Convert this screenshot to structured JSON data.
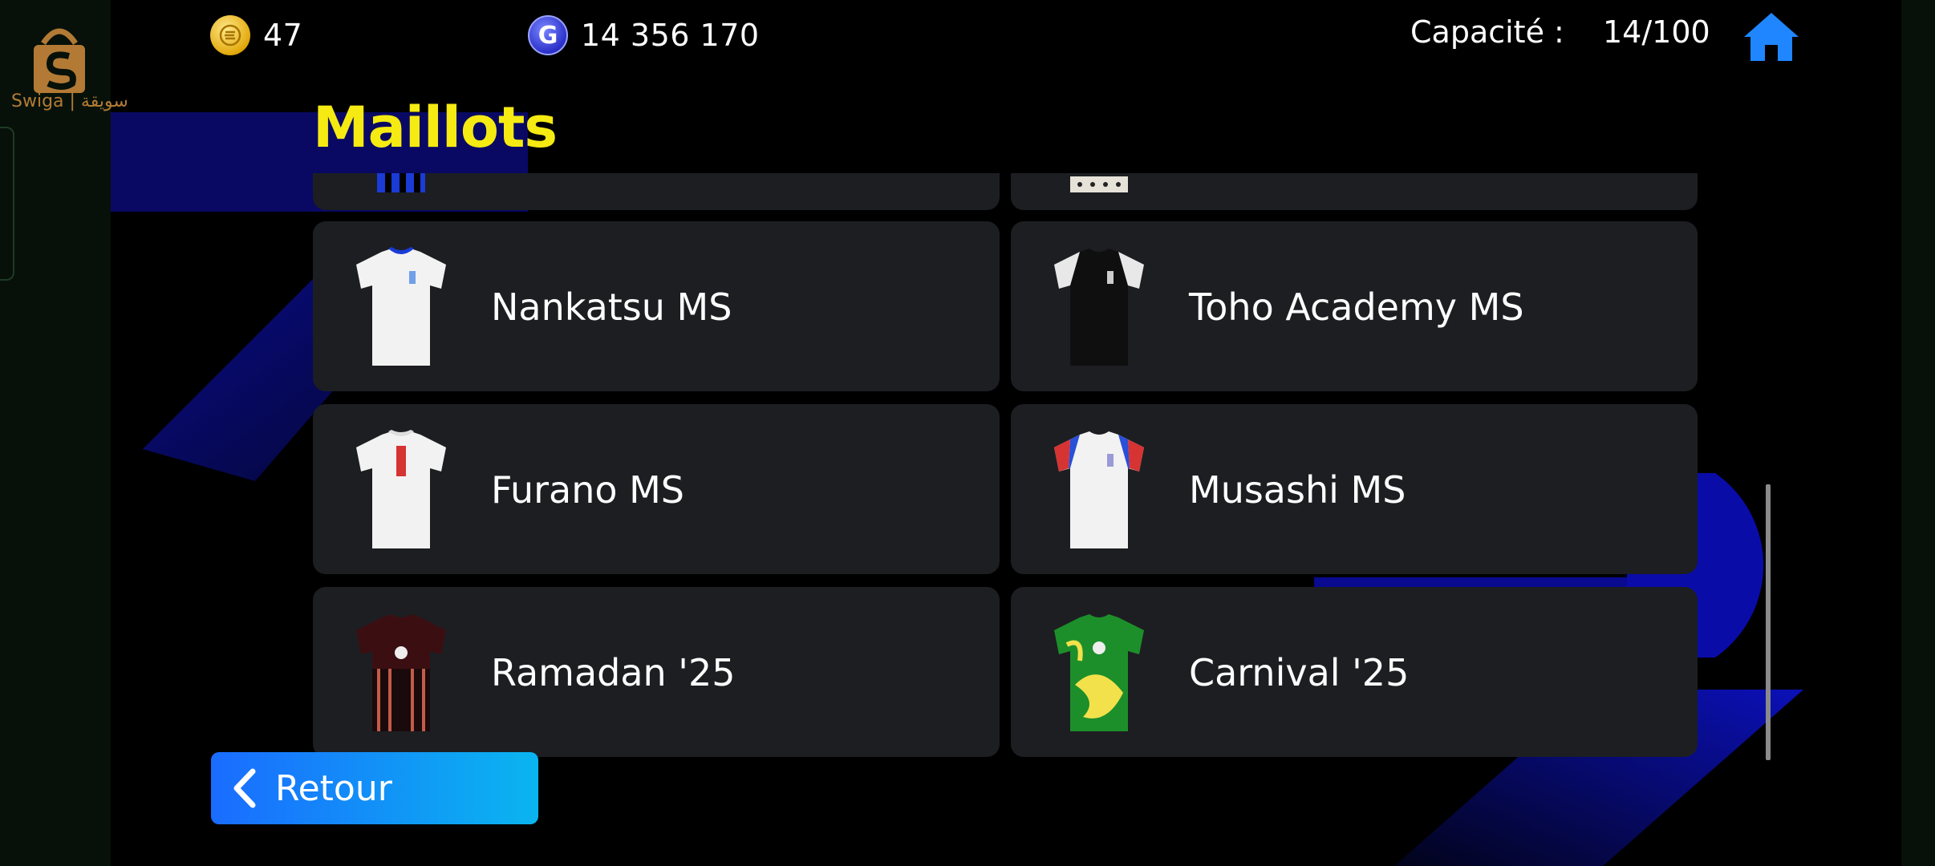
{
  "watermark": {
    "text": "Swiga | سويقة"
  },
  "topbar": {
    "ecoins": "47",
    "gp": "14 356 170",
    "capacity_label": "Capacité :",
    "capacity_value": "14/100",
    "home_icon": "home-icon"
  },
  "page": {
    "title": "Maillots"
  },
  "kits": [
    {
      "label": "Nankatsu MS",
      "jersey": "white-blue-collar"
    },
    {
      "label": "Toho Academy MS",
      "jersey": "black-white-sleeves"
    },
    {
      "label": "Furano MS",
      "jersey": "white-red-print"
    },
    {
      "label": "Musashi MS",
      "jersey": "white-blue-red-sleeves"
    },
    {
      "label": "Ramadan '25",
      "jersey": "dark-red-pattern"
    },
    {
      "label": "Carnival '25",
      "jersey": "green-yellow-pattern"
    }
  ],
  "back": {
    "label": "Retour"
  },
  "colors": {
    "title": "#f5ea12",
    "card": "#1d1e22",
    "button_start": "#1a6cff",
    "button_end": "#0ab5f0"
  }
}
